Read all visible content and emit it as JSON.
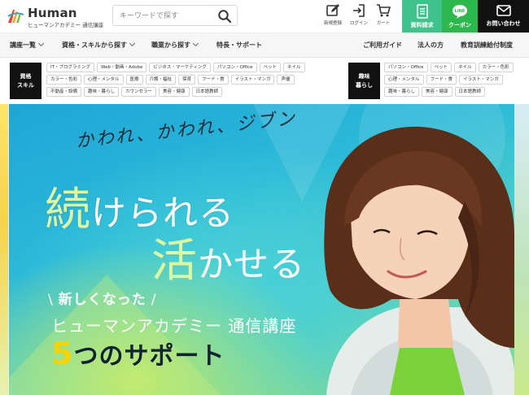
{
  "header": {
    "logo_title": "Human",
    "logo_subtitle": "ヒューマンアカデミー 通信講座",
    "search_placeholder": "キーワードで探す",
    "icons": [
      {
        "name": "edit-icon",
        "label": "新規登録"
      },
      {
        "name": "login-icon",
        "label": "ログイン"
      },
      {
        "name": "cart-icon",
        "label": "カート"
      }
    ],
    "buttons": [
      {
        "name": "brochure-icon",
        "label": "資料請求",
        "color": "#3fc28b"
      },
      {
        "name": "line-icon",
        "label": "クーポン",
        "color": "#2db84d",
        "badge": "LINE"
      },
      {
        "name": "mail-icon",
        "label": "お問い合わせ",
        "color": "#111111"
      }
    ]
  },
  "nav": {
    "left": [
      "講座一覧",
      "資格・スキルから探す",
      "職業から探す",
      "特長・サポート"
    ],
    "right": [
      "ご利用ガイド",
      "法人の方",
      "教育訓練給付制度"
    ]
  },
  "tag_panel": {
    "qualifications": {
      "title_line1": "資格",
      "title_line2": "スキル",
      "tags": [
        "IT・プログラミング",
        "Web・動画・Adobe",
        "ビジネス・マーケティング",
        "パソコン・Office",
        "ペット",
        "ネイル",
        "カラー・色彩",
        "心理・メンタル",
        "医療",
        "介護・福祉",
        "保育",
        "フード・食",
        "イラスト・マンガ",
        "声優",
        "不動産・設備",
        "趣味・暮らし",
        "カウンセラー",
        "美容・健康",
        "日本語教師"
      ]
    },
    "hobby": {
      "title_line1": "趣味",
      "title_line2": "暮らし",
      "tags": [
        "パソコン・Office",
        "ペット",
        "ネイル",
        "カラー・色彩",
        "心理・メンタル",
        "フード・食",
        "イラスト・マンガ",
        "趣味・暮らし",
        "美容・健康",
        "日本語教師"
      ]
    }
  },
  "hero": {
    "handwriting": "かわれ、かわれ、ジブン",
    "line1_big": "続",
    "line1_rest": "けられる",
    "line2_big": "活",
    "line2_rest": "かせる",
    "renewed_slash_left": "\\",
    "renewed": "新しくなった",
    "renewed_slash_right": "/",
    "course_name": "ヒューマンアカデミー 通信講座",
    "support_num": "5",
    "support_rest": "つのサポート"
  },
  "colors": {
    "accent_green": "#3fc28b",
    "line_green": "#2db84d",
    "hero_blue": "#1ea6d6",
    "highlight_yellow": "#f5d400"
  }
}
